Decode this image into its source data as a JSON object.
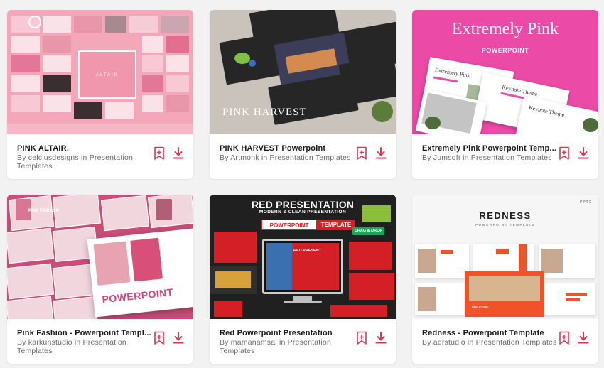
{
  "cards": [
    {
      "title": "PINK ALTAIR.",
      "author": "celciusdesigns",
      "connector": "in",
      "category": "Presentation Templates",
      "thumb": {
        "center_text": "ALTAIR"
      }
    },
    {
      "title": "PINK HARVEST Powerpoint",
      "author": "Artmonk",
      "connector": "in",
      "category": "Presentation Templates",
      "thumb": {
        "brand": "PINK HARVEST"
      }
    },
    {
      "title": "Extremely Pink Powerpoint Temp...",
      "author": "Jumsoft",
      "connector": "in",
      "category": "Presentation Templates",
      "thumb": {
        "headline": "Extremely Pink",
        "sub": "POWERPOINT",
        "slide1": "Extremely Pink",
        "slide2": "Keynote Theme",
        "slide3": "Keynote Theme"
      }
    },
    {
      "title": "Pink Fashion - Powerpoint Templ...",
      "author": "karkunstudio",
      "connector": "in",
      "category": "Presentation Templates",
      "thumb": {
        "brand": "PINK FASHION",
        "ppt": "POWERPOINT"
      }
    },
    {
      "title": "Red Powerpoint Presentation",
      "author": "mamanamsai",
      "connector": "in",
      "category": "Presentation Templates",
      "thumb": {
        "h1": "RED PRESENTATION",
        "h2": "MODERN & CLEAN PRESENTATION",
        "pill1": "POWERPOINT",
        "pill2": "TEMPLATE",
        "pill3": "DRAG & DROP",
        "screen": "RED PRESENT"
      }
    },
    {
      "title": "Redness - Powerpoint Template",
      "author": "aqrstudio",
      "connector": "in",
      "category": "Presentation Templates",
      "thumb": {
        "title": "REDNESS",
        "sub": "POWERPOINT TEMPLATE",
        "tag": "PPTX",
        "welcome": "WELCOME"
      }
    }
  ],
  "icons": {
    "bookmark": "bookmark-plus-icon",
    "download": "download-icon"
  },
  "colors": {
    "accent": "#e0354f",
    "card_bg": "#ffffff",
    "page_bg": "#f2f2f2"
  }
}
